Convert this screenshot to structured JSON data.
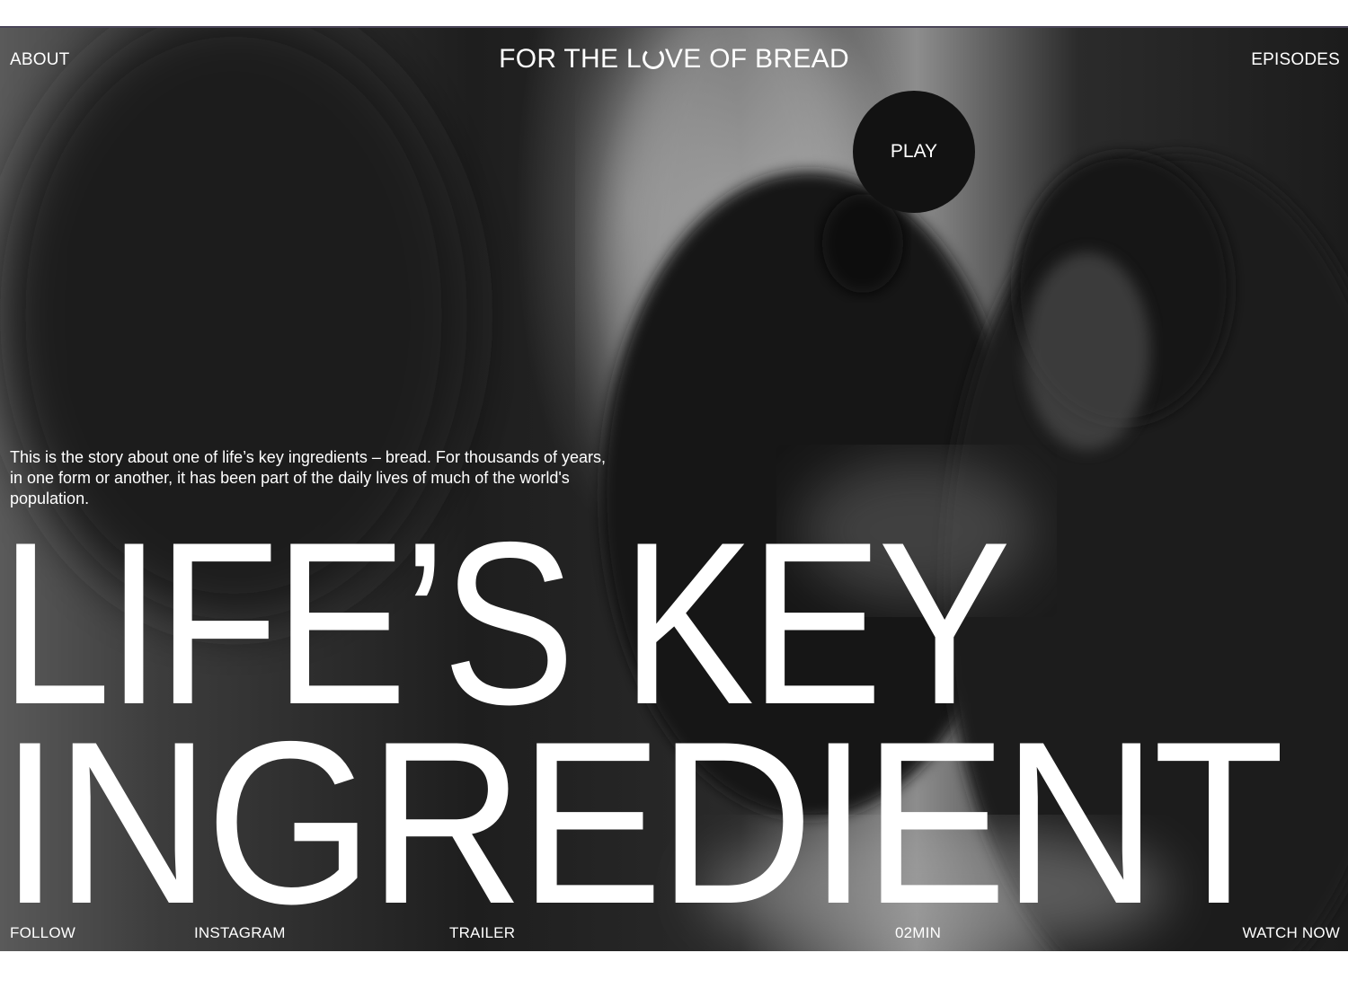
{
  "header": {
    "about_label": "ABOUT",
    "brand_before": "FOR THE L",
    "brand_after": "VE OF BREAD",
    "episodes_label": "EPISODES"
  },
  "hero": {
    "play_label": "PLAY",
    "intro": "This is the story about one of life’s key ingredients – bread. For thousands of years, in one form or another, it has been part of the daily lives of much of the world's population.",
    "headline_line_1": "LIFE’S KEY",
    "headline_line_2": "INGREDIENT"
  },
  "footer": {
    "follow_label": "FOLLOW",
    "instagram_label": "INSTAGRAM",
    "trailer_label": "TRAILER",
    "duration": "02MIN",
    "watch_label": "WATCH NOW"
  },
  "colors": {
    "text": "#ffffff",
    "play_button": "#121212",
    "page_background": "#ffffff"
  },
  "icons": {
    "brand_o": "heart-open-circle-icon"
  }
}
